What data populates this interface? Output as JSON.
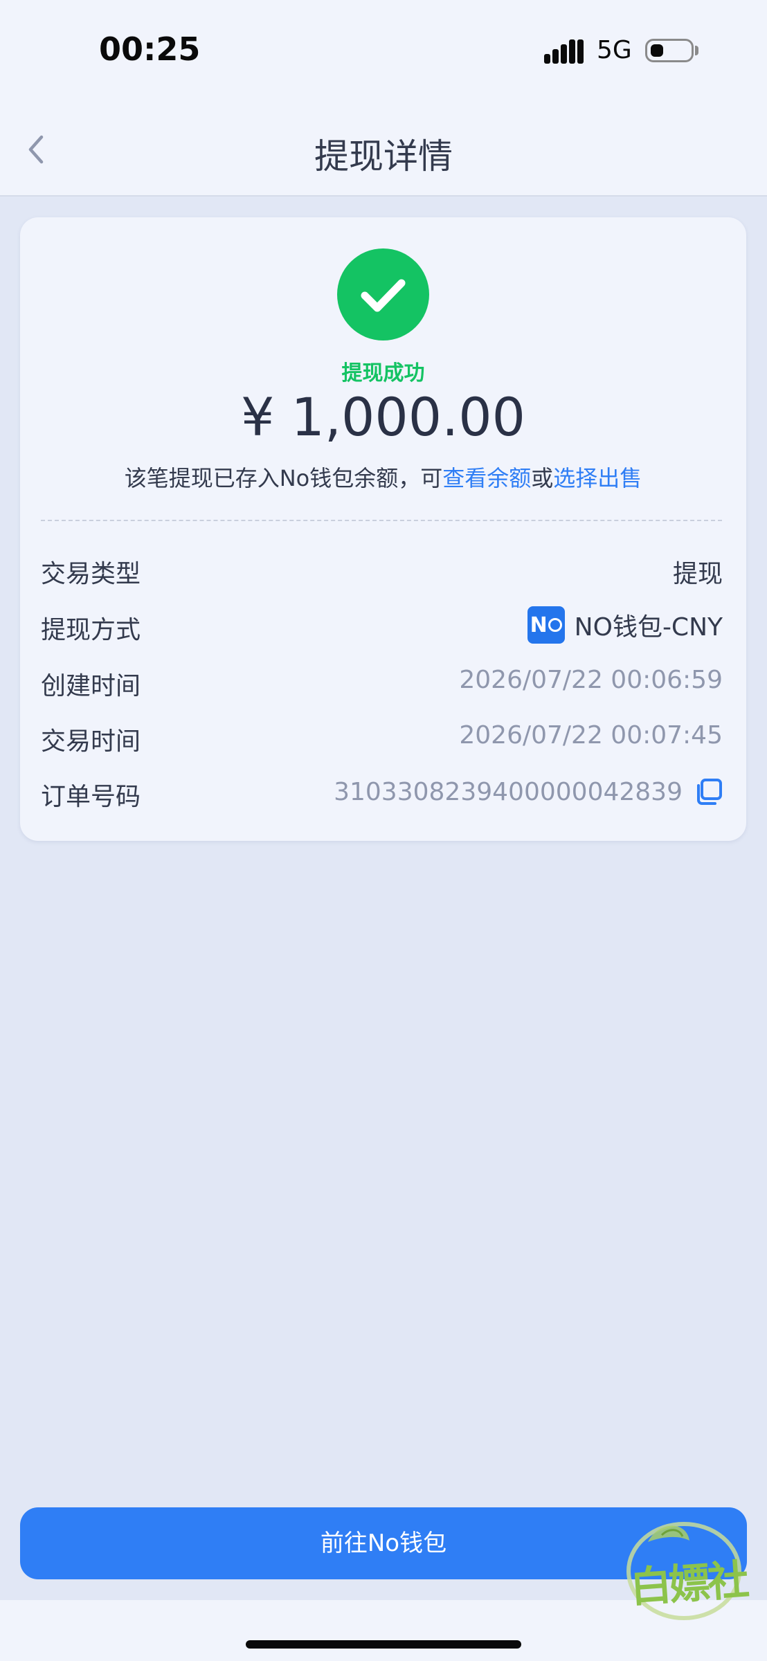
{
  "status_bar": {
    "time": "00:25",
    "network": "5G"
  },
  "nav": {
    "title": "提现详情"
  },
  "result": {
    "status": "提现成功",
    "amount": "¥ 1,000.00",
    "note_prefix": "该笔提现已存入No钱包余额，可",
    "link_balance": "查看余额",
    "note_or": "或",
    "link_sell": "选择出售"
  },
  "details": {
    "type": {
      "label": "交易类型",
      "value": "提现"
    },
    "method": {
      "label": "提现方式",
      "logo_text": "N",
      "value": "NO钱包-CNY"
    },
    "created": {
      "label": "创建时间",
      "value": "2026/07/22 00:06:59"
    },
    "traded": {
      "label": "交易时间",
      "value": "2026/07/22 00:07:45"
    },
    "order": {
      "label": "订单号码",
      "value": "3103308239400000042839"
    }
  },
  "cta": {
    "label": "前往No钱包"
  },
  "watermark": {
    "text": "白嫖社"
  },
  "colors": {
    "accent": "#2f7ef5",
    "success": "#14c363",
    "page_bg": "#e1e7f5",
    "card_bg": "#f1f4fc",
    "muted": "#8f97ad"
  }
}
